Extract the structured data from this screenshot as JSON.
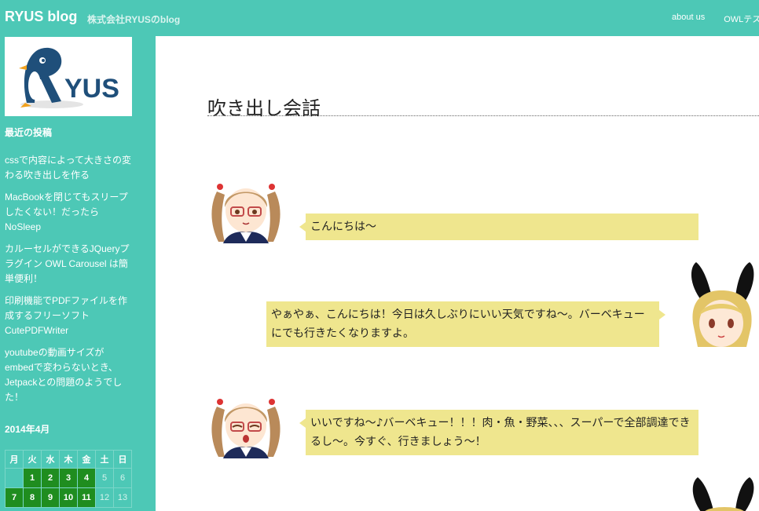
{
  "header": {
    "site_title": "RYUS blog",
    "tagline": "株式会社RYUSのblog",
    "nav": [
      "about us",
      "OWLテス"
    ]
  },
  "sidebar": {
    "logo_text": "YUS",
    "recent_heading": "最近の投稿",
    "recent_posts": [
      "cssで内容によって大きさの変わる吹き出しを作る",
      "MacBookを閉じてもスリープしたくない！だったらNoSleep",
      "カルーセルができるJQueryプラグイン OWL Carousel は簡単便利！",
      "印刷機能でPDFファイルを作成するフリーソフトCutePDFWriter",
      "youtubeの動画サイズがembedで変わらないとき、Jetpackとの問題のようでした！"
    ],
    "calendar": {
      "caption": "2014年4月",
      "weekdays": [
        "月",
        "火",
        "水",
        "木",
        "金",
        "土",
        "日"
      ],
      "week1": [
        "",
        "1",
        "2",
        "3",
        "4",
        "5",
        "6"
      ],
      "week2": [
        "7",
        "8",
        "9",
        "10",
        "11",
        "12",
        "13"
      ]
    }
  },
  "main": {
    "title": "吹き出し会話",
    "messages": [
      {
        "speaker": "girl-glasses",
        "text": "こんにちは〜"
      },
      {
        "speaker": "girl-bunny",
        "text": "やぁやぁ、こんにちは！今日は久しぶりにいい天気ですね〜。バーベキューにでも行きたくなりますよ。"
      },
      {
        "speaker": "girl-glasses",
        "text": "いいですね〜♪バーベキュー！！！肉・魚・野菜、、、スーパーで全部調達できるし〜。今すぐ、行きましょう〜！"
      }
    ]
  },
  "colors": {
    "accent": "#4dc8b6",
    "bubble": "#efe68e",
    "calendar_link": "#1f8d1f"
  }
}
